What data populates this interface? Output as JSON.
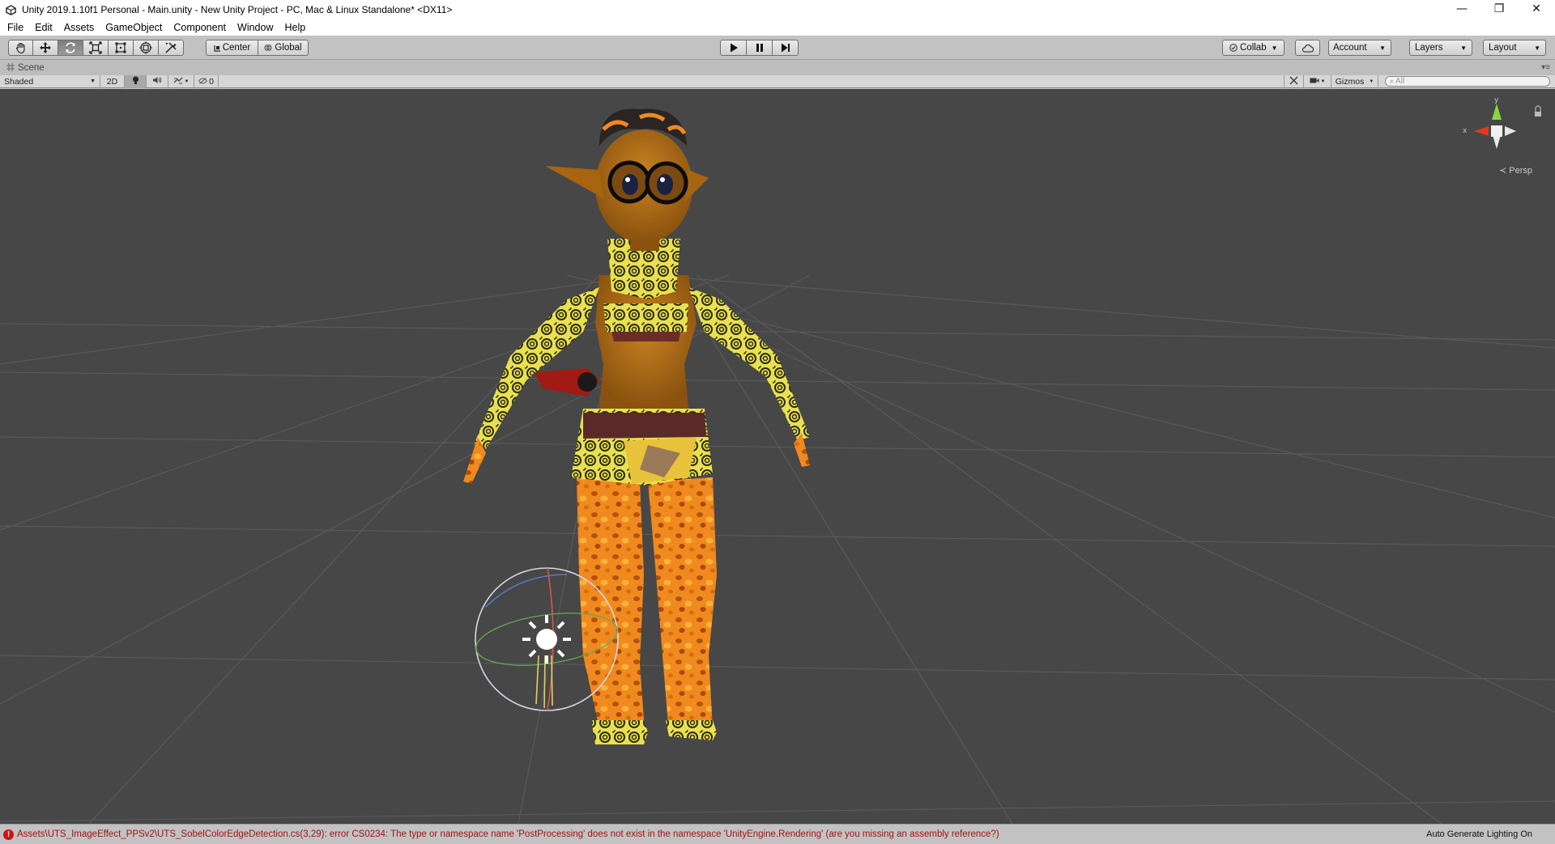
{
  "window": {
    "title": "Unity 2019.1.10f1 Personal - Main.unity - New Unity Project - PC, Mac & Linux Standalone* <DX11>",
    "app_icon": "unity-logo-icon",
    "controls": {
      "minimize": "—",
      "restore": "❐",
      "close": "✕"
    }
  },
  "menu": [
    "File",
    "Edit",
    "Assets",
    "GameObject",
    "Component",
    "Window",
    "Help"
  ],
  "toolbar": {
    "tools": [
      {
        "name": "hand-tool",
        "icon": "hand-icon"
      },
      {
        "name": "move-tool",
        "icon": "move-icon"
      },
      {
        "name": "rotate-tool",
        "icon": "rotate-icon",
        "active": true
      },
      {
        "name": "scale-tool",
        "icon": "scale-icon"
      },
      {
        "name": "rect-tool",
        "icon": "rect-icon"
      },
      {
        "name": "transform-tool",
        "icon": "transform-icon"
      },
      {
        "name": "custom-tool",
        "icon": "custom-tool-icon"
      }
    ],
    "pivot_label": "Center",
    "space_label": "Global",
    "collab_label": "Collab",
    "account_label": "Account",
    "layers_label": "Layers",
    "layout_label": "Layout"
  },
  "scene_tab": {
    "label": "Scene"
  },
  "scene_toolbar": {
    "draw_mode": "Shaded",
    "mode_2d": "2D",
    "hidden_count": "0",
    "gizmos_label": "Gizmos",
    "search_placeholder": "All"
  },
  "viewport": {
    "projection": "Persp",
    "gizmo_axes": {
      "x": "x",
      "y": "y"
    },
    "background_color": "#474747",
    "grid_color": "#595959"
  },
  "status": {
    "error_message": "Assets\\UTS_ImageEffect_PPSv2\\UTS_SobelColorEdgeDetection.cs(3,29): error CS0234: The type or namespace name 'PostProcessing' does not exist in the namespace 'UnityEngine.Rendering' (are you missing an assembly reference?)",
    "lighting": "Auto Generate Lighting On",
    "error_color": "#a51212"
  }
}
